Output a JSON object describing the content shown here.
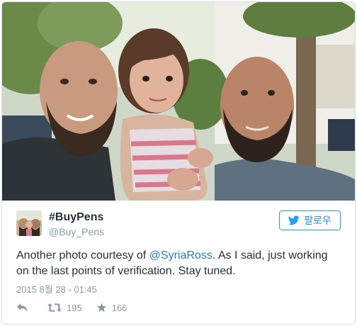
{
  "tweet": {
    "display_name": "#BuyPens",
    "handle": "@Buy_Pens",
    "follow_label": "팔로우",
    "text_before": "Another photo courtesy of ",
    "mention": "@SyriaRoss",
    "text_after": ". As I said, just working on the last points of verification. Stay tuned.",
    "timestamp": "2015 8월 28 - 01:45",
    "retweet_count": "195",
    "like_count": "166"
  },
  "icons": {
    "follow": "twitter-bird-icon",
    "reply": "reply-icon",
    "retweet": "retweet-icon",
    "like": "star-icon"
  },
  "colors": {
    "link": "#2b7bb9",
    "follow_border": "#1da1f2",
    "muted": "#8899a6",
    "text": "#292f33"
  }
}
